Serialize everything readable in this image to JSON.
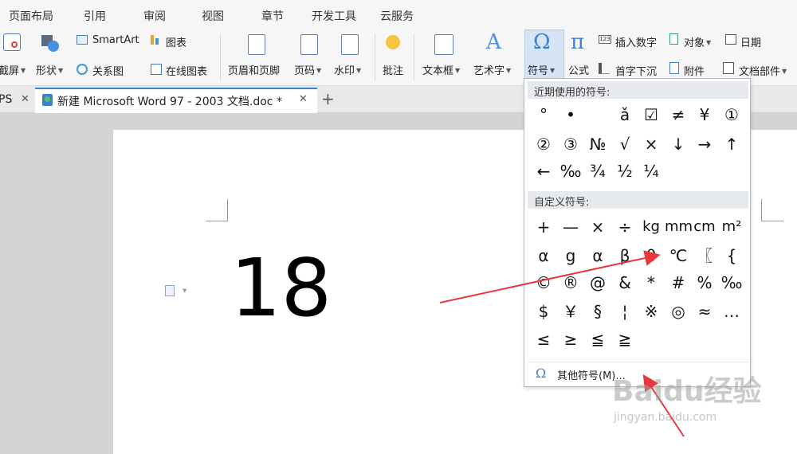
{
  "menu": {
    "items": [
      "页面布局",
      "引用",
      "审阅",
      "视图",
      "章节",
      "开发工具",
      "云服务"
    ]
  },
  "ribbon": {
    "screenshot": "截屏",
    "shapes": "形状",
    "smartart": "SmartArt",
    "chart": "图表",
    "relation": "关系图",
    "online_chart": "在线图表",
    "header_footer": "页眉和页脚",
    "page_num": "页码",
    "watermark": "水印",
    "comment": "批注",
    "textbox": "文本框",
    "wordart": "艺术字",
    "symbol": "符号",
    "formula": "公式",
    "insert_number": "插入数字",
    "object": "对象",
    "date": "日期",
    "drop_cap": "首字下沉",
    "attachment": "附件",
    "doc_parts": "文档部件"
  },
  "tabs": {
    "prev_tab": "PS",
    "active_tab": "新建 Microsoft Word 97 - 2003 文档.doc *",
    "add": "+"
  },
  "document": {
    "content": "18"
  },
  "dropdown": {
    "recent_header": "近期使用的符号:",
    "recent_row1": [
      "°",
      "•",
      "",
      "ǎ",
      "☑",
      "≠",
      "¥",
      "①"
    ],
    "recent_row2": [
      "②",
      "③",
      "№",
      "√",
      "×",
      "↓",
      "→",
      "↑"
    ],
    "recent_row3": [
      "←",
      "‰",
      "¾",
      "½",
      "¼"
    ],
    "custom_header": "自定义符号:",
    "custom_row1": [
      "+",
      "—",
      "×",
      "÷",
      "kg",
      "mm",
      "cm",
      "m²"
    ],
    "custom_row2": [
      "α",
      "g",
      "α",
      "β",
      "θ",
      "℃",
      "〖",
      "{"
    ],
    "custom_row3": [
      "©",
      "®",
      "@",
      "&",
      "*",
      "#",
      "%",
      "‰"
    ],
    "custom_row4": [
      "$",
      "￥",
      "§",
      "¦",
      "※",
      "◎",
      "≈",
      "…"
    ],
    "custom_row5": [
      "≤",
      "≥",
      "≦",
      "≧"
    ],
    "more_symbols": "其他符号(M)..."
  },
  "watermark": {
    "brand": "Baidu经验",
    "url": "jingyan.baidu.com"
  },
  "colors": {
    "accent": "#3d7fd0",
    "arrow": "#e8383d",
    "symbol_highlight": "#d5e5f6"
  }
}
